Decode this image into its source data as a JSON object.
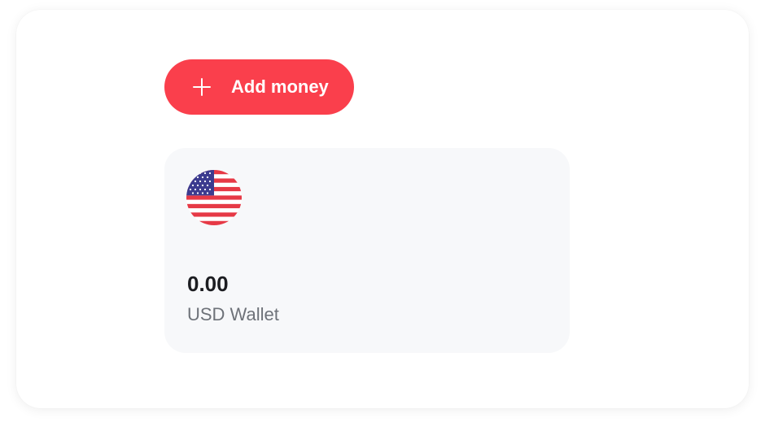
{
  "actions": {
    "add_money_label": "Add money"
  },
  "wallet": {
    "balance": "0.00",
    "name": "USD Wallet",
    "flag_icon": "us-flag-icon"
  },
  "colors": {
    "accent": "#fa3f4c",
    "card_background": "#f7f8fa",
    "flag_red": "#e63946",
    "flag_blue": "#3c3b8f"
  }
}
